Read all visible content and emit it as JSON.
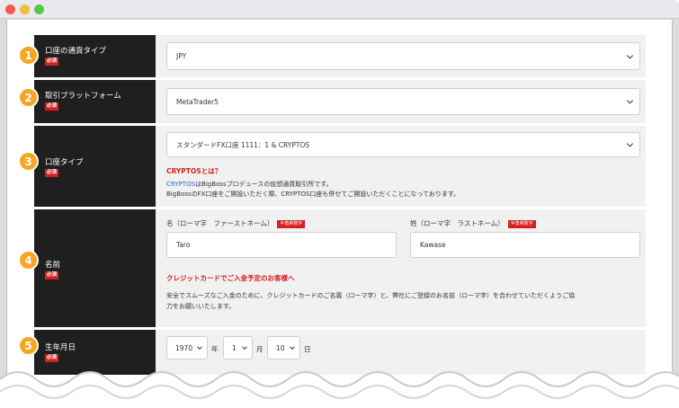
{
  "window": {
    "controls": [
      "close",
      "minimize",
      "maximize"
    ]
  },
  "steps": [
    "1",
    "2",
    "3",
    "4",
    "5"
  ],
  "currency": {
    "label": "口座の通貨タイプ",
    "required": "必須",
    "value": "JPY"
  },
  "platform": {
    "label": "取引プラットフォーム",
    "required": "必須",
    "value": "MetaTrader5"
  },
  "account_type": {
    "label": "口座タイプ",
    "required": "必須",
    "value": "スタンダードFX口座 1111：1 & CRYPTOS",
    "info_heading": "CRYPTOSとは？",
    "info_link": "CRYPTOS",
    "info_line1_rest": "はBigBossプロデュースの仮想通貨取引所です。",
    "info_line2": "BigBossのFX口座をご開設いただく際、CRYPTOS口座も併せてご開設いただくことになっております。"
  },
  "name": {
    "label": "名前",
    "required": "必須",
    "first_label": "名（ローマ字　ファーストネーム）",
    "first_tag": "半角英数字",
    "first_value": "Taro",
    "last_label": "姓（ローマ字　ラストネーム）",
    "last_tag": "半角英数字",
    "last_value": "Kawase",
    "notice_heading": "クレジットカードでご入金予定のお客様へ",
    "notice_line1": "安全でスムーズなご入金のために、クレジットカードのご名義（ローマ字）と、弊社にご登録のお名前（ローマ字）を合わせていただくようご協",
    "notice_line2": "力をお願いいたします。"
  },
  "birthdate": {
    "label": "生年月日",
    "required": "必須",
    "year": "1970",
    "year_unit": "年",
    "month": "1",
    "month_unit": "月",
    "day": "10",
    "day_unit": "日"
  }
}
